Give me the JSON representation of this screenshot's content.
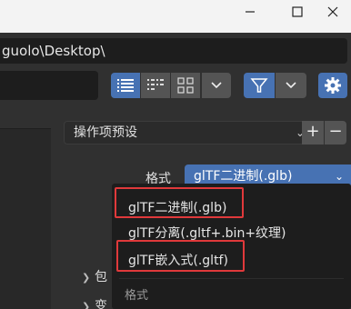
{
  "window": {
    "min_glyph": "—",
    "max_glyph": "☐",
    "close_glyph": "✕"
  },
  "path": {
    "value": "guolo\\Desktop\\"
  },
  "toolbar": {
    "view_dropdown_glyph": "⌄",
    "filter_dropdown_glyph": "⌄",
    "accent": "#4772b3"
  },
  "operator_presets": {
    "label": "操作项预设",
    "add": "+",
    "remove": "−"
  },
  "format": {
    "label": "格式",
    "selected": "glTF二进制(.glb)",
    "options": [
      "glTF二进制(.glb)",
      "glTF分离(.gltf+.bin+纹理)",
      "glTF嵌入式(.gltf)"
    ],
    "menu_title": "格式"
  },
  "tree": {
    "row_1": "包",
    "row_2": "变"
  },
  "highlight_color": "#e0393b"
}
